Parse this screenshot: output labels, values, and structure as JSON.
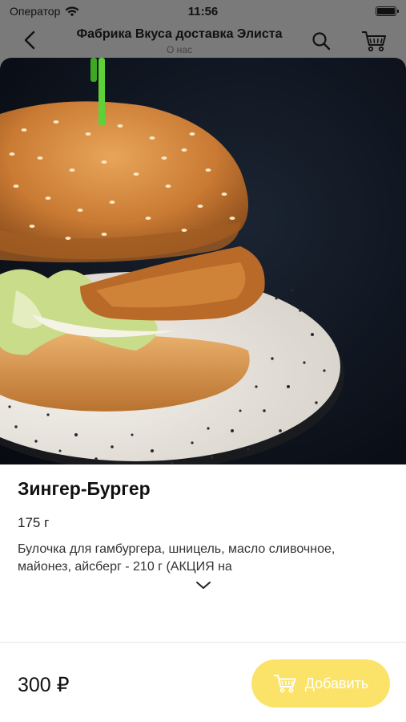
{
  "status_bar": {
    "carrier": "Оператор",
    "time": "11:56",
    "battery_level": 1.0
  },
  "nav": {
    "title": "Фабрика Вкуса доставка Элиста",
    "subtitle": "О нас",
    "icons": {
      "back": "chevron-left-icon",
      "search": "search-icon",
      "cart": "cart-icon"
    }
  },
  "product": {
    "name": "Зингер-Бургер",
    "weight": "175 г",
    "description": "Булочка для гамбургера, шницель, масло сливочное, майонез, айсберг - 210 г (АКЦИЯ на",
    "price": "300 ₽",
    "add_label": "Добавить"
  },
  "colors": {
    "accent": "#fbe36a",
    "dim_overlay": "#7a7a7a"
  }
}
